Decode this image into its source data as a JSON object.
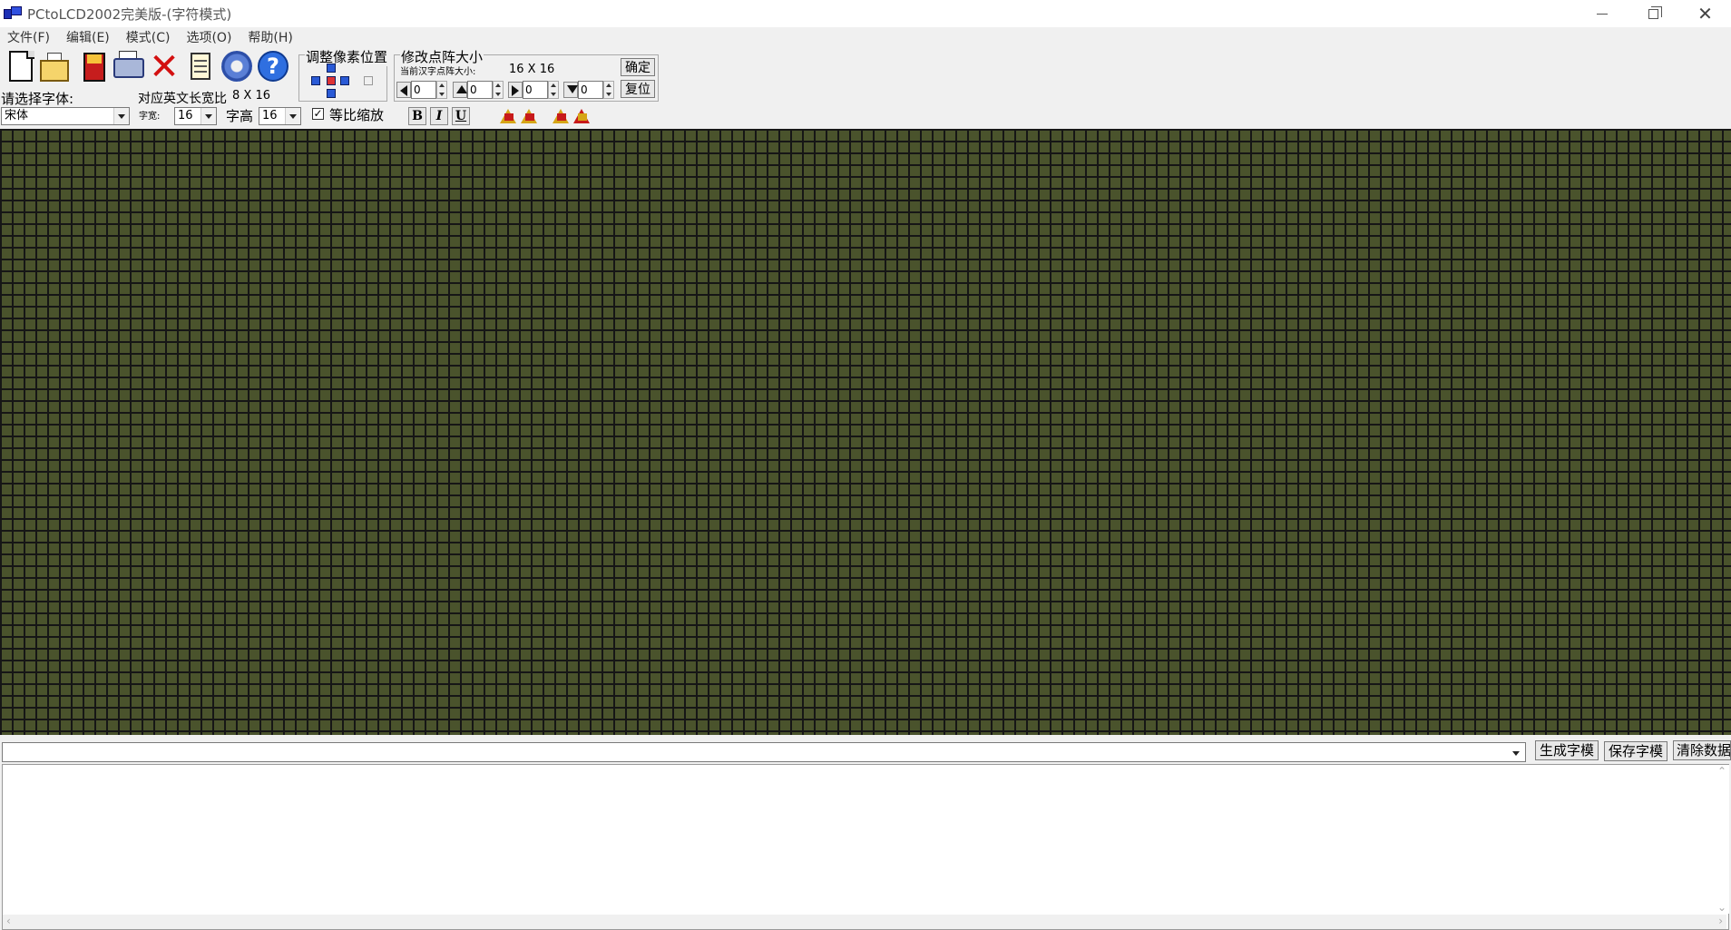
{
  "window": {
    "title": "PCtoLCD2002完美版-(字符模式)",
    "icons": {
      "minimize": "minimize-icon",
      "maximize": "restore-icon",
      "close": "close-icon"
    }
  },
  "menu": [
    "文件(F)",
    "编辑(E)",
    "模式(C)",
    "选项(O)",
    "帮助(H)"
  ],
  "toolbar_icons": [
    "new-file-icon",
    "open-folder-icon",
    "save-disk-icon",
    "print-icon",
    "delete-icon",
    "document-icon",
    "settings-gear-icon",
    "help-icon"
  ],
  "adjust_group": {
    "title": "调整像素位置"
  },
  "matrix_group": {
    "title": "修改点阵大小",
    "current_label": "当前汉字点阵大小:",
    "size_value": "16  X  16",
    "confirm_button": "确定",
    "reset_button": "复位",
    "spin_values": [
      "0",
      "0",
      "0",
      "0"
    ]
  },
  "font_section": {
    "select_font_label": "请选择字体:",
    "font_value": "宋体",
    "ratio_label": "对应英文长宽比",
    "ratio_value": "8  X  16",
    "width_label": "字宽:",
    "width_value": "16",
    "height_label": "字高",
    "height_value": "16",
    "scale_checkbox_label": "等比缩放",
    "scale_checked": "✓"
  },
  "format_buttons": [
    "B",
    "I",
    "U"
  ],
  "bottom": {
    "combo_value": "",
    "generate_button": "生成字模",
    "save_button": "保存字模",
    "clear_button": "清除数据",
    "output_text": ""
  }
}
